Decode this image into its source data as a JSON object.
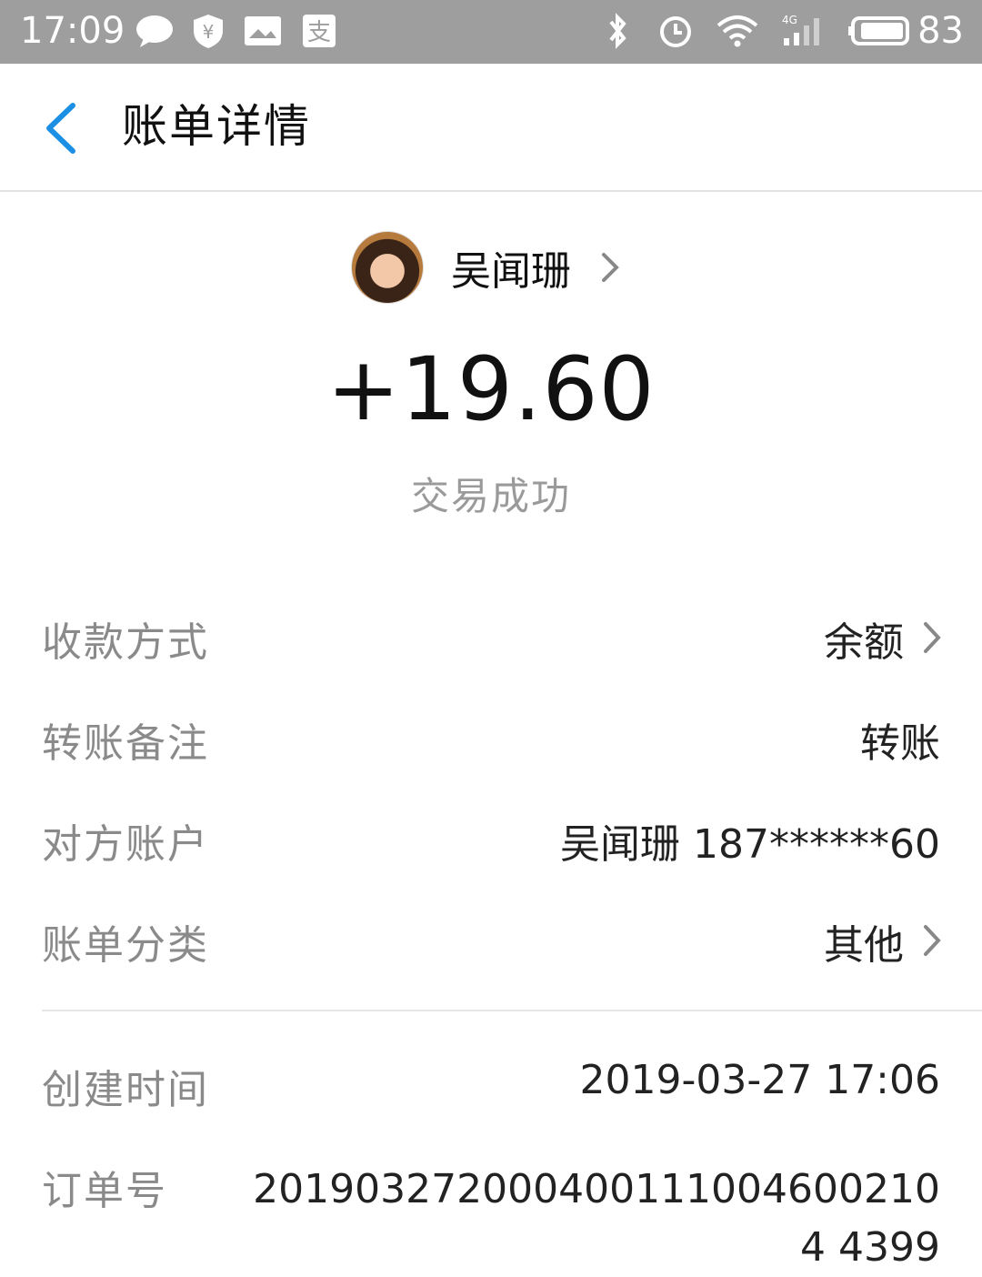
{
  "status_bar": {
    "time": "17:09",
    "battery": "83",
    "network": "4G",
    "icons": [
      "chat-bubble-icon",
      "shield-yen-icon",
      "image-card-icon",
      "alipay-icon",
      "bluetooth-icon",
      "alarm-icon",
      "wifi-icon",
      "signal-icon",
      "battery-icon"
    ]
  },
  "header": {
    "title": "账单详情"
  },
  "counterparty": {
    "name": "吴闻珊"
  },
  "transaction": {
    "amount": "+19.60",
    "status": "交易成功"
  },
  "details": [
    {
      "label": "收款方式",
      "value": "余额",
      "has_chevron": true
    },
    {
      "label": "转账备注",
      "value": "转账",
      "has_chevron": false
    },
    {
      "label": "对方账户",
      "value": "吴闻珊 187******60",
      "has_chevron": false
    },
    {
      "label": "账单分类",
      "value": "其他",
      "has_chevron": true
    }
  ],
  "meta": {
    "created_label": "创建时间",
    "created_value": "2019-03-27 17:06",
    "order_label": "订单号",
    "order_value": "2019032720004001110046002104 4399"
  },
  "colors": {
    "status_bar_bg": "#9e9e9e",
    "accent": "#1a8fe3",
    "label_gray": "#8a8a8a"
  }
}
